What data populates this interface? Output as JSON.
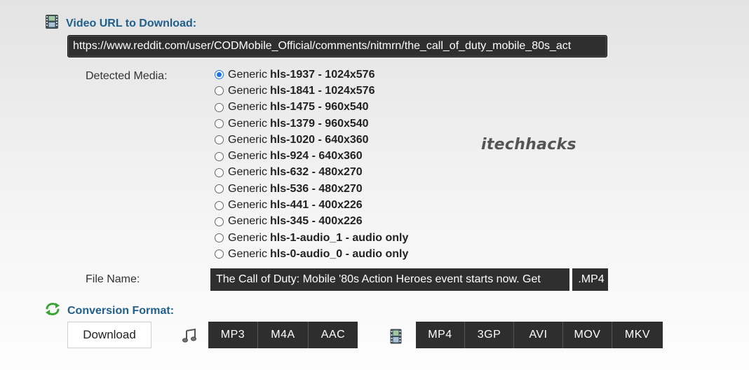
{
  "video_section": {
    "title": "Video URL to Download:",
    "icon": "film-strip-icon",
    "url_value": "https://www.reddit.com/user/CODMobile_Official/comments/nitmrn/the_call_of_duty_mobile_80s_act"
  },
  "detected_media": {
    "label": "Detected Media:",
    "items": [
      {
        "prefix": "Generic",
        "code": "hls-1937 - 1024x576",
        "checked": true
      },
      {
        "prefix": "Generic",
        "code": "hls-1841 - 1024x576",
        "checked": false
      },
      {
        "prefix": "Generic",
        "code": "hls-1475 - 960x540",
        "checked": false
      },
      {
        "prefix": "Generic",
        "code": "hls-1379 - 960x540",
        "checked": false
      },
      {
        "prefix": "Generic",
        "code": "hls-1020 - 640x360",
        "checked": false
      },
      {
        "prefix": "Generic",
        "code": "hls-924 - 640x360",
        "checked": false
      },
      {
        "prefix": "Generic",
        "code": "hls-632 - 480x270",
        "checked": false
      },
      {
        "prefix": "Generic",
        "code": "hls-536 - 480x270",
        "checked": false
      },
      {
        "prefix": "Generic",
        "code": "hls-441 - 400x226",
        "checked": false
      },
      {
        "prefix": "Generic",
        "code": "hls-345 - 400x226",
        "checked": false
      },
      {
        "prefix": "Generic",
        "code": "hls-1-audio_1 - audio only",
        "checked": false
      },
      {
        "prefix": "Generic",
        "code": "hls-0-audio_0 - audio only",
        "checked": false
      }
    ]
  },
  "watermark": "itechhacks",
  "file_name": {
    "label": "File Name:",
    "value": "The Call of Duty: Mobile '80s Action Heroes event starts now. Get",
    "extension": ".MP4"
  },
  "conversion": {
    "title": "Conversion Format:",
    "icon": "refresh-arrows-icon",
    "download_label": "Download",
    "audio_icon": "music-note-icon",
    "audio_formats": [
      "MP3",
      "M4A",
      "AAC"
    ],
    "video_icon": "film-strip-icon",
    "video_formats": [
      "MP4",
      "3GP",
      "AVI",
      "MOV",
      "MKV"
    ]
  },
  "colors": {
    "accent_heading": "#1f5f8b",
    "dark_field": "#2f2f2f",
    "radio_selected": "#1a73e8",
    "refresh_icon_green": "#3aa335"
  }
}
